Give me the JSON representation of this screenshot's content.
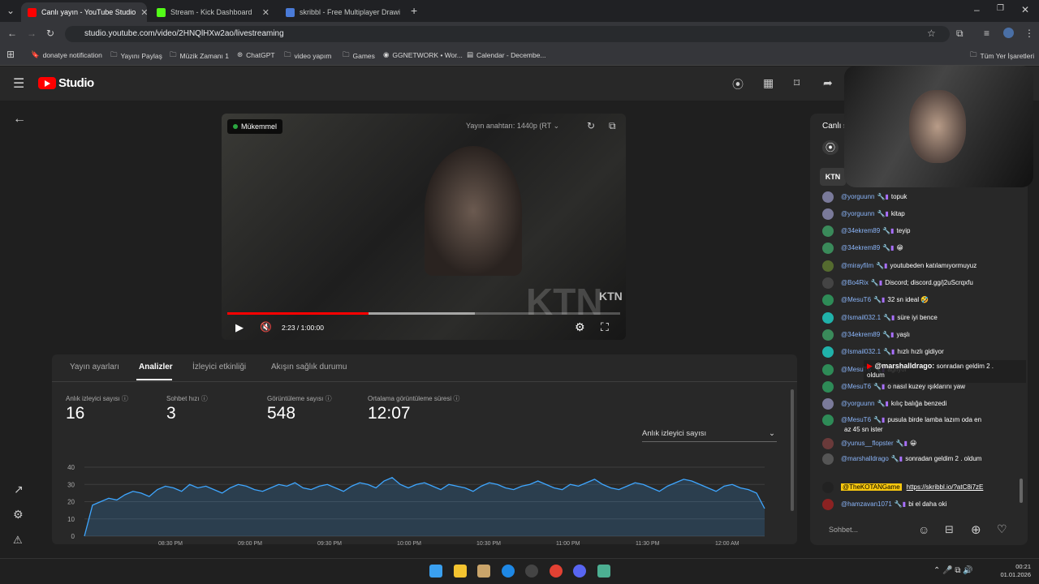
{
  "browser": {
    "tabs": [
      {
        "title": "Canlı yayın - YouTube Studio",
        "color": "#ff0000"
      },
      {
        "title": "Stream - Kick Dashboard",
        "color": "#53fc18"
      },
      {
        "title": "skribbl - Free Multiplayer Drawi",
        "color": "#4a7bd8"
      }
    ],
    "url": "studio.youtube.com/video/2HNQlHXw2ao/livestreaming",
    "bookmarks": [
      "donatye notification",
      "Yayını Paylaş",
      "Müzik Zamanı 1",
      "ChatGPT",
      "video yapım",
      "Games",
      "GGNETWORK • Wor...",
      "Calendar - Decembe..."
    ],
    "all_bookmarks": "Tüm Yer İşaretleri"
  },
  "studio": {
    "logo": "Studio"
  },
  "video": {
    "status": "Mükemmel",
    "stream_key": "Yayın anahtarı: 1440p (RT",
    "time": "2:23 / 1:00:00",
    "progress": 0.36,
    "buffer": 0.63,
    "watermark": "KTN"
  },
  "tabs": [
    "Yayın ayarları",
    "Analizler",
    "İzleyici etkinliği",
    "Akışın sağlık durumu"
  ],
  "stats": [
    {
      "label": "Anlık izleyici sayısı",
      "value": "16"
    },
    {
      "label": "Sohbet hızı",
      "value": "3"
    },
    {
      "label": "Görüntüleme sayısı",
      "value": "548"
    },
    {
      "label": "Ortalama görüntüleme süresi",
      "value": "12:07"
    }
  ],
  "metric_select": "Anlık izleyici sayısı",
  "chart_data": {
    "type": "area",
    "y_ticks": [
      "40",
      "30",
      "20",
      "10",
      "0"
    ],
    "ylim": [
      0,
      40
    ],
    "x_ticks": [
      "08:30 PM",
      "09:00 PM",
      "09:30 PM",
      "10:00 PM",
      "10:30 PM",
      "11:00 PM",
      "11:30 PM",
      "12:00 AM"
    ],
    "values": [
      0,
      18,
      20,
      22,
      21,
      24,
      26,
      25,
      23,
      27,
      29,
      28,
      26,
      30,
      28,
      29,
      27,
      25,
      28,
      30,
      29,
      27,
      26,
      28,
      30,
      29,
      31,
      28,
      27,
      29,
      30,
      28,
      26,
      29,
      31,
      30,
      28,
      32,
      34,
      30,
      28,
      30,
      31,
      29,
      27,
      30,
      29,
      28,
      26,
      29,
      31,
      30,
      28,
      27,
      29,
      30,
      32,
      30,
      28,
      27,
      30,
      29,
      31,
      33,
      30,
      28,
      27,
      29,
      31,
      30,
      28,
      26,
      29,
      31,
      33,
      32,
      30,
      28,
      26,
      29,
      30,
      28,
      27,
      25,
      16
    ]
  },
  "chat": {
    "title": "Canlı s",
    "messages": [
      {
        "user": "@yorguunn",
        "text": "topuk",
        "color": "#7a7a9a"
      },
      {
        "user": "@yorguunn",
        "text": "kitap",
        "color": "#7a7a9a"
      },
      {
        "user": "@34ekrem89",
        "text": "teyip",
        "color": "#3a8a5a"
      },
      {
        "user": "@34ekrem89",
        "text": "😁",
        "color": "#3a8a5a"
      },
      {
        "user": "@mirayfilm",
        "text": "youtubeden katılamıyormuyuz",
        "color": "#556b2f"
      },
      {
        "user": "@Bo4Rix",
        "text": "Discord; discord.gg/j2uScrqxfu",
        "color": "#444"
      },
      {
        "user": "@MesuT6",
        "text": "32 sn ideal 🤣",
        "color": "#2e8b57"
      },
      {
        "user": "@Ismail032.1",
        "text": "süre iyi bence",
        "color": "#20b2aa"
      },
      {
        "user": "@34ekrem89",
        "text": "yaşlı",
        "color": "#3a8a5a"
      },
      {
        "user": "@Ismail032.1",
        "text": "hızlı hızlı gidiyor",
        "color": "#20b2aa"
      },
      {
        "user": "@MesuT6",
        "text": "ağlıyor",
        "color": "#2e8b57"
      },
      {
        "user": "@MesuT6",
        "text": "o nasıl kuzey ışıklarını yaw",
        "color": "#2e8b57"
      },
      {
        "user": "@yorguunn",
        "text": "kılıç balığa benzedi",
        "color": "#7a7a9a"
      },
      {
        "user": "@MesuT6",
        "text": "pusula birde lamba lazım oda en",
        "color": "#2e8b57"
      },
      {
        "user": "@yunus__flopster",
        "text": "😀",
        "color": "#6a3a3a"
      },
      {
        "user": "@marshalldrago",
        "text": "sonradan geldim 2 . oldum",
        "color": "#555"
      },
      {
        "user": "@TheKOTANGame",
        "text": "https://skribbl.io/?atC8i7zE",
        "color": "#222"
      },
      {
        "user": "@hamzavan1071",
        "text": "bi el daha oki",
        "color": "#8b2222"
      }
    ],
    "msg13_cont": "az 45 sn ister",
    "overlay_user": "@marshalldrago:",
    "overlay_text": "sonradan geldim 2 .",
    "overlay_text2": "oldum",
    "input_placeholder": "Sohbet..."
  },
  "taskbar": {
    "time": "00:21",
    "date": "01.01.2026"
  }
}
